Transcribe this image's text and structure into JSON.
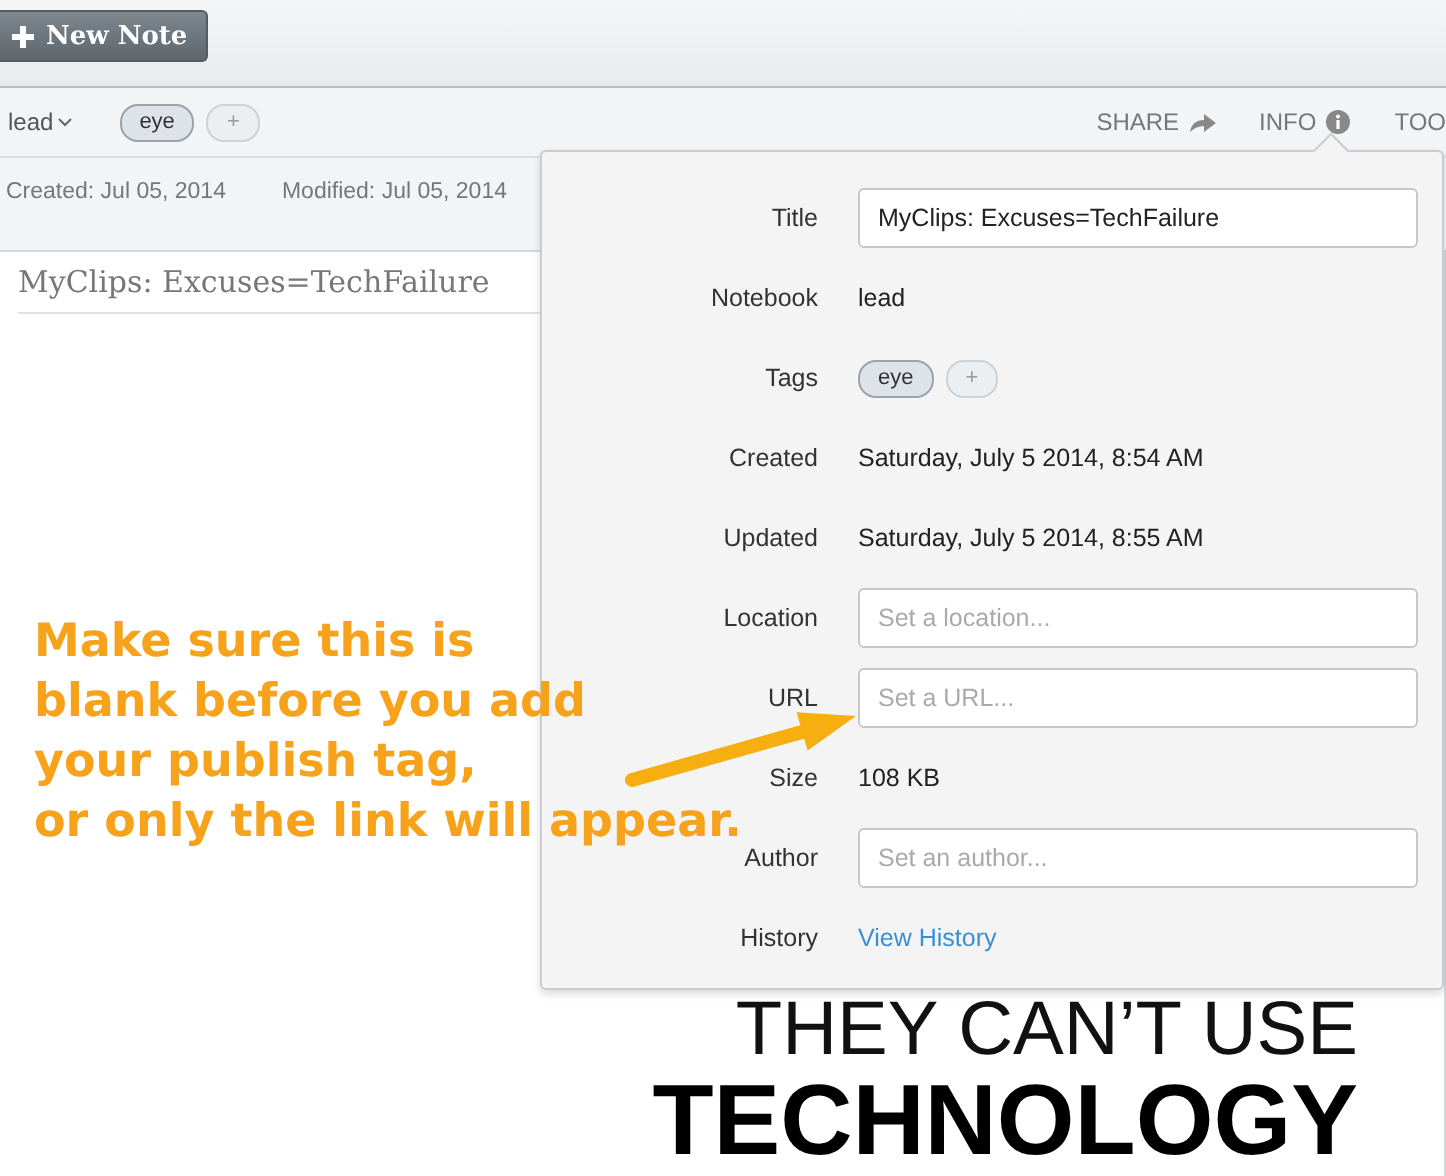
{
  "toolbar": {
    "new_note_button": "New Note"
  },
  "note_bar": {
    "notebook": "lead",
    "tags": [
      {
        "label": "eye",
        "kind": "tag"
      },
      {
        "label": "+",
        "kind": "add"
      }
    ],
    "actions": [
      {
        "label": "SHARE",
        "kind": "share"
      },
      {
        "label": "INFO",
        "kind": "info"
      },
      {
        "label": "TOO",
        "kind": "plain"
      }
    ]
  },
  "dates": {
    "created": "Created: Jul 05, 2014",
    "modified": "Modified: Jul 05, 2014"
  },
  "note": {
    "title": "MyClips: Excuses=TechFailure",
    "content_lines": [
      "THEY CAN’T USE",
      "TECHNOLOGY"
    ]
  },
  "info_panel": {
    "rows": [
      {
        "label": "Title",
        "kind": "input",
        "value": "MyClips: Excuses=TechFailure"
      },
      {
        "label": "Notebook",
        "kind": "text",
        "value": "lead"
      },
      {
        "label": "Tags",
        "kind": "tags",
        "tags": [
          "eye",
          "+"
        ]
      },
      {
        "label": "Created",
        "kind": "text",
        "value": "Saturday, July 5 2014, 8:54 AM"
      },
      {
        "label": "Updated",
        "kind": "text",
        "value": "Saturday, July 5 2014, 8:55 AM"
      },
      {
        "label": "Location",
        "kind": "input",
        "placeholder": "Set a location..."
      },
      {
        "label": "URL",
        "kind": "input",
        "placeholder": "Set a URL..."
      },
      {
        "label": "Size",
        "kind": "text",
        "value": "108 KB"
      },
      {
        "label": "Author",
        "kind": "input",
        "placeholder": "Set an author..."
      },
      {
        "label": "History",
        "kind": "link",
        "value": "View History"
      }
    ]
  },
  "annotation": {
    "lines": [
      "Make sure this is",
      "blank before you add",
      "your publish tag,",
      "or only the link will appear."
    ]
  }
}
